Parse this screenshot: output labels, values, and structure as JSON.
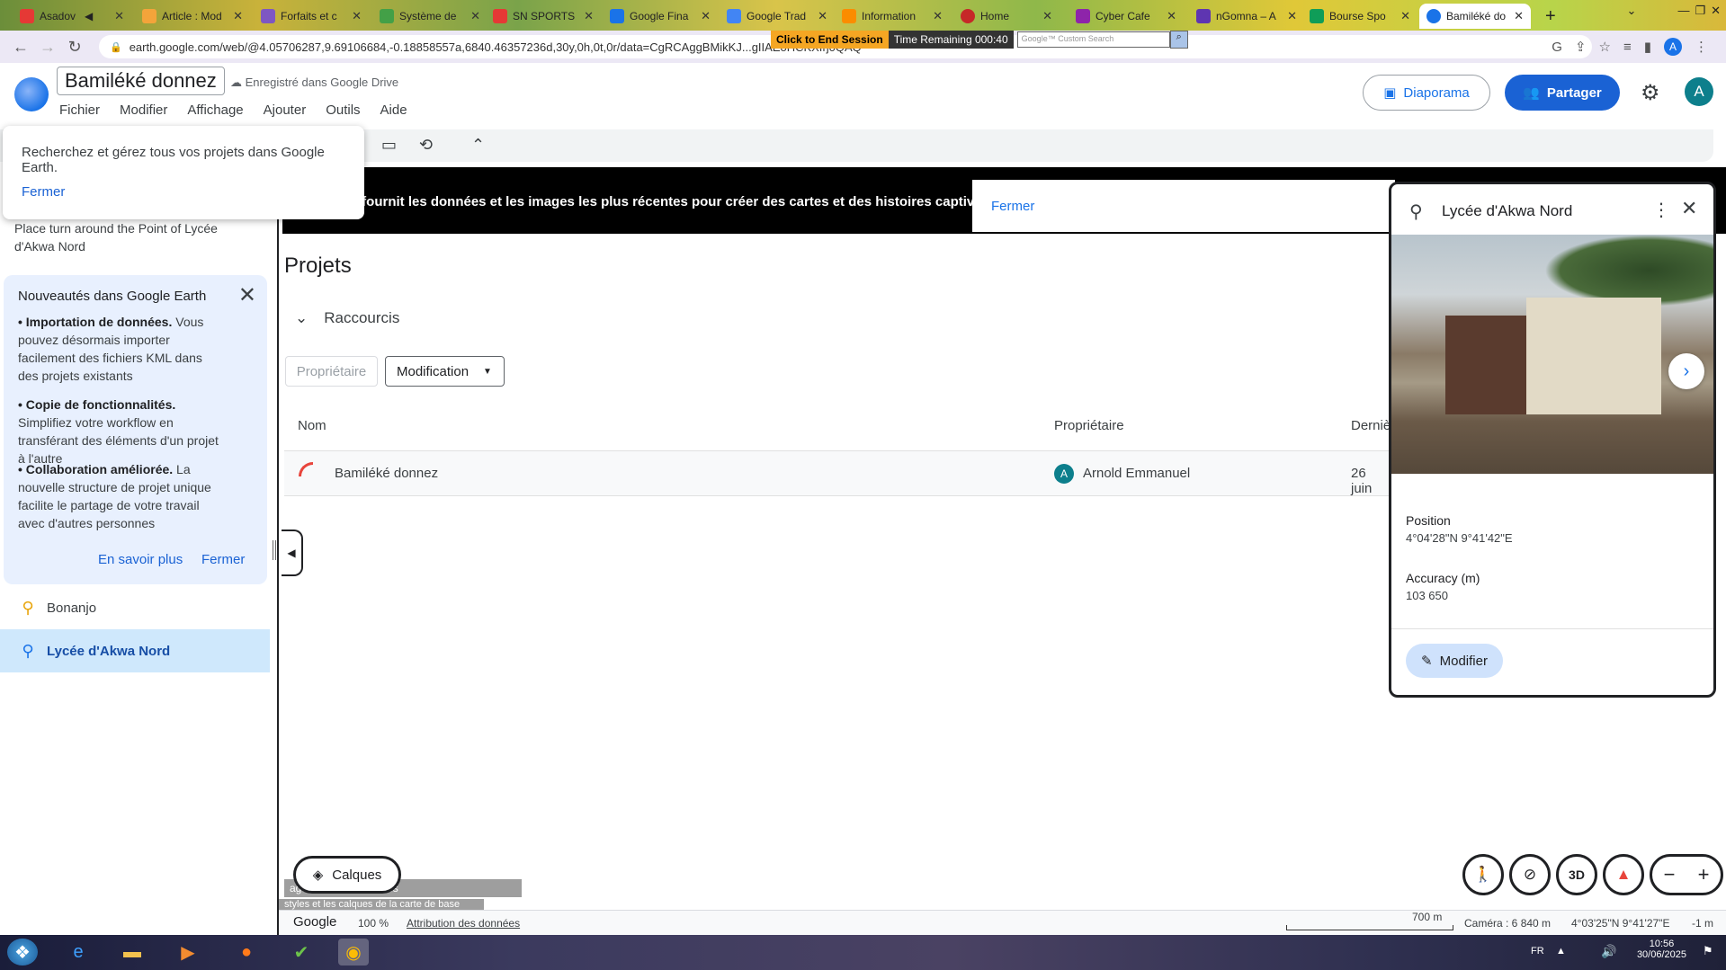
{
  "browser": {
    "tabs": [
      {
        "title": "Asadov",
        "color": "#e53935"
      },
      {
        "title": "Article : Mod",
        "color": "#f4a43a"
      },
      {
        "title": "Forfaits et c",
        "color": "#7e57c2"
      },
      {
        "title": "Système de",
        "color": "#43a047"
      },
      {
        "title": "SN SPORTS",
        "color": "#e53935"
      },
      {
        "title": "Google Fina",
        "color": "#1a73e8"
      },
      {
        "title": "Google Trad",
        "color": "#4285f4"
      },
      {
        "title": "Information",
        "color": "#fb8c00"
      },
      {
        "title": "Home",
        "color": "#c62828"
      },
      {
        "title": "Cyber Cafe",
        "color": "#8e24aa"
      },
      {
        "title": "nGomna – A",
        "color": "#5e35b1"
      },
      {
        "title": "Bourse Spo",
        "color": "#0f9d58"
      },
      {
        "title": "Bamiléké do",
        "color": "#1a73e8"
      }
    ],
    "url": "earth.google.com/web/@4.05706287,9.69106684,-0.18858557a,6840.46357236d,30y,0h,0t,0r/data=CgRCAggBMikKJ...gIIAEoHCKXfrj0QAQ",
    "profile_initial": "A"
  },
  "session": {
    "end_label": "Click to End Session",
    "time_label": "Time Remaining 000:40",
    "search_placeholder": "Google™ Custom Search"
  },
  "app": {
    "project_title": "Bamiléké donnez",
    "drive_status": "Enregistré dans Google Drive",
    "menu": [
      "Fichier",
      "Modifier",
      "Affichage",
      "Ajouter",
      "Outils",
      "Aide"
    ],
    "slideshow_label": "Diaporama",
    "share_label": "Partager",
    "avatar_initial": "A"
  },
  "banner": {
    "text": "rth fournit les données et les images les plus récentes pour créer des cartes et des histoires captivantes",
    "close_label": "Fermer"
  },
  "popup": {
    "text": "Recherchez et gérez tous vos projets dans Google Earth.",
    "close_label": "Fermer"
  },
  "leftpanel": {
    "description": "Place turn around the Point of Lycée d'Akwa Nord",
    "news": {
      "title": "Nouveautés dans Google Earth",
      "items": [
        {
          "head": "• Importation de données.",
          "body": " Vous pouvez désormais importer facilement des fichiers KML dans des projets existants"
        },
        {
          "head": "• Copie de fonctionnalités.",
          "body": " Simplifiez votre workflow en transférant des éléments d'un projet à l'autre"
        },
        {
          "head": "• Collaboration améliorée.",
          "body": " La nouvelle structure de projet unique facilite le partage de votre travail avec d'autres personnes"
        }
      ],
      "learn_more": "En savoir plus",
      "close_label": "Fermer"
    },
    "features": [
      {
        "name": "Bonanjo",
        "pin_color": "#e8a50c"
      },
      {
        "name": "Lycée d'Akwa Nord",
        "pin_color": "#1a73e8"
      }
    ]
  },
  "projects": {
    "title": "Projets",
    "shortcuts_label": "Raccourcis",
    "filter_owner": "Propriétaire",
    "filter_modification": "Modification",
    "columns": {
      "name": "Nom",
      "owner": "Propriétaire",
      "date": "Derniè"
    },
    "rows": [
      {
        "name": "Bamiléké donnez",
        "owner_initial": "A",
        "owner": "Arnold Emmanuel",
        "date": "26 juin"
      }
    ]
  },
  "placecard": {
    "title": "Lycée d'Akwa Nord",
    "position_label": "Position",
    "position_value": "4°04'28\"N 9°41'42\"E",
    "accuracy_label": "Accuracy (m)",
    "accuracy_value": "103 650",
    "modify_label": "Modifier"
  },
  "map": {
    "layers_label": "Calques",
    "tip_1": "ages satellite actuelles",
    "tip_2": "styles et les calques de la carte de base",
    "btn_3d": "3D",
    "zoom_out": "−",
    "zoom_in": "+"
  },
  "status": {
    "logo": "Google",
    "zoom": "100 %",
    "attribution": "Attribution des données",
    "scale": "700 m",
    "camera": "Caméra : 6 840 m",
    "coords": "4°03'25\"N 9°41'27\"E",
    "elevation": "-1 m"
  },
  "taskbar": {
    "lang": "FR",
    "time": "10:56",
    "date": "30/06/2025"
  }
}
